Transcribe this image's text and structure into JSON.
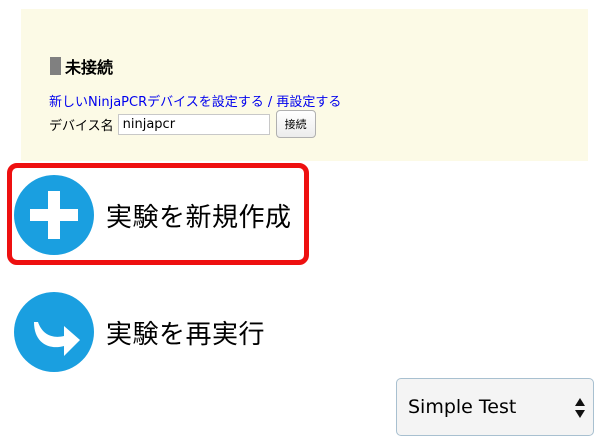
{
  "connection": {
    "status_label": "未接続",
    "setup_link_label": "新しいNinjaPCRデバイスを設定する / 再設定する",
    "device_name_label": "デバイス名",
    "device_name_value": "ninjapcr",
    "connect_button_label": "接続"
  },
  "actions": {
    "new_experiment_label": "実験を新規作成",
    "rerun_experiment_label": "実験を再実行"
  },
  "experiment_select": {
    "selected": "Simple Test"
  },
  "colors": {
    "panel_bg": "#fcfae6",
    "action_icon_blue": "#1a9fe0",
    "highlight_red": "#ee1010",
    "link": "#0000ee"
  },
  "icons": {
    "new_experiment": "plus-circle-icon",
    "rerun_experiment": "redo-arrow-circle-icon",
    "select_arrows": "up-down-arrows-icon"
  }
}
